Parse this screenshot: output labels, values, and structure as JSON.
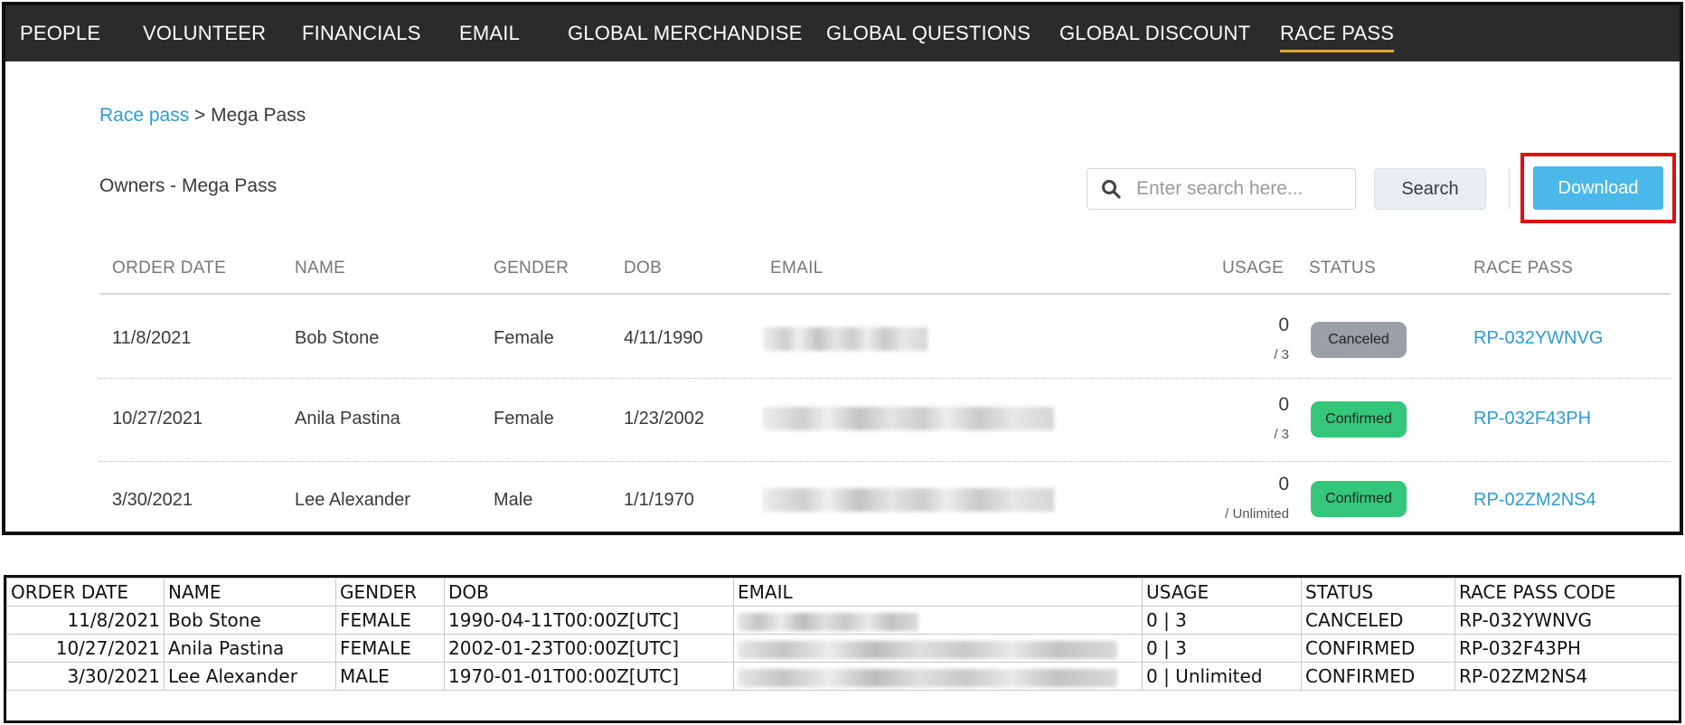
{
  "nav": {
    "items": [
      {
        "label": "PEOPLE"
      },
      {
        "label": "VOLUNTEER"
      },
      {
        "label": "FINANCIALS"
      },
      {
        "label": "EMAIL"
      },
      {
        "label": "GLOBAL MERCHANDISE"
      },
      {
        "label": "GLOBAL QUESTIONS"
      },
      {
        "label": "GLOBAL DISCOUNT"
      },
      {
        "label": "RACE PASS"
      }
    ],
    "active": "RACE PASS"
  },
  "breadcrumb": {
    "parent": "Race pass",
    "separator": " > ",
    "current": "Mega Pass"
  },
  "page_title": "Owners - Mega Pass",
  "search": {
    "placeholder": "Enter search here...",
    "value": "",
    "button_label": "Search"
  },
  "download_label": "Download",
  "colors": {
    "nav_bg": "#2b2b2b",
    "active_underline": "#e0a92c",
    "link": "#2d9bd4",
    "download": "#4ab8e8",
    "confirmed": "#34c77a",
    "canceled": "#9aa0a6",
    "highlight": "#e01010"
  },
  "owners_table": {
    "headers": [
      "ORDER DATE",
      "NAME",
      "GENDER",
      "DOB",
      "EMAIL",
      "USAGE",
      "STATUS",
      "RACE PASS"
    ],
    "rows": [
      {
        "order_date": "11/8/2021",
        "name": "Bob Stone",
        "gender": "Female",
        "dob": "4/11/1990",
        "usage": "0",
        "usage_limit": "/ 3",
        "status": "Canceled",
        "race_pass": "RP-032YWNVG"
      },
      {
        "order_date": "10/27/2021",
        "name": "Anila Pastina",
        "gender": "Female",
        "dob": "1/23/2002",
        "usage": "0",
        "usage_limit": "/ 3",
        "status": "Confirmed",
        "race_pass": "RP-032F43PH"
      },
      {
        "order_date": "3/30/2021",
        "name": "Lee Alexander",
        "gender": "Male",
        "dob": "1/1/1970",
        "usage": "0",
        "usage_limit": "/ Unlimited",
        "status": "Confirmed",
        "race_pass": "RP-02ZM2NS4"
      }
    ]
  },
  "export_sheet": {
    "headers": [
      "ORDER DATE",
      "NAME",
      "GENDER",
      "DOB",
      "EMAIL",
      "USAGE",
      "STATUS",
      "RACE PASS CODE"
    ],
    "rows": [
      {
        "order_date": "11/8/2021",
        "name": "Bob Stone",
        "gender": "FEMALE",
        "dob": "1990-04-11T00:00Z[UTC]",
        "usage": "0 | 3",
        "status": "CANCELED",
        "code": "RP-032YWNVG"
      },
      {
        "order_date": "10/27/2021",
        "name": "Anila Pastina",
        "gender": "FEMALE",
        "dob": "2002-01-23T00:00Z[UTC]",
        "usage": "0 | 3",
        "status": "CONFIRMED",
        "code": "RP-032F43PH"
      },
      {
        "order_date": "3/30/2021",
        "name": "Lee Alexander",
        "gender": "MALE",
        "dob": "1970-01-01T00:00Z[UTC]",
        "usage": "0 | Unlimited",
        "status": "CONFIRMED",
        "code": "RP-02ZM2NS4"
      }
    ]
  }
}
